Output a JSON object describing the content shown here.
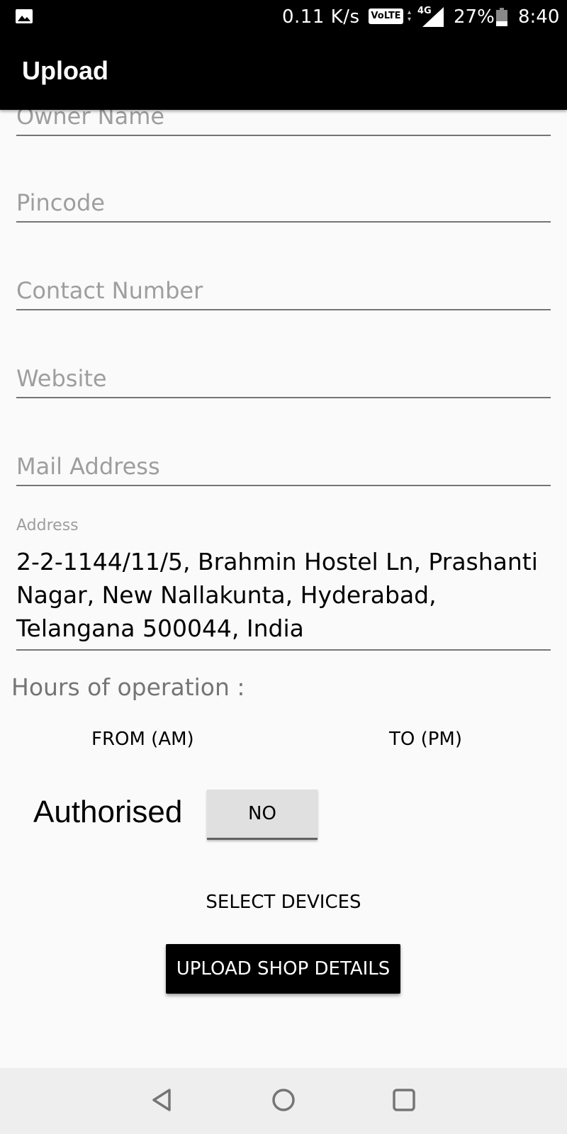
{
  "status_bar": {
    "gallery_icon": "image-icon",
    "speed": "0.11 K/s",
    "volte": "VoLTE",
    "network": "4G",
    "battery": "27%",
    "time": "8:40"
  },
  "app_bar": {
    "title": "Upload"
  },
  "form": {
    "owner_name_placeholder": "Owner Name",
    "pincode_placeholder": "Pincode",
    "contact_placeholder": "Contact Number",
    "website_placeholder": "Website",
    "mail_placeholder": "Mail Address",
    "address_label": "Address",
    "address_value": "2-2-1144/11/5, Brahmin Hostel Ln, Prashanti Nagar, New Nallakunta, Hyderabad, Telangana 500044, India"
  },
  "hours": {
    "label": "Hours of operation :",
    "from": "FROM (AM)",
    "to": "TO (PM)"
  },
  "authorised": {
    "label": "Authorised",
    "toggle": "NO"
  },
  "actions": {
    "select_devices": "SELECT DEVICES",
    "upload": "UPLOAD SHOP DETAILS"
  },
  "nav_bar": {
    "back_icon": "back-icon",
    "home_icon": "home-icon",
    "recents_icon": "recents-icon"
  }
}
